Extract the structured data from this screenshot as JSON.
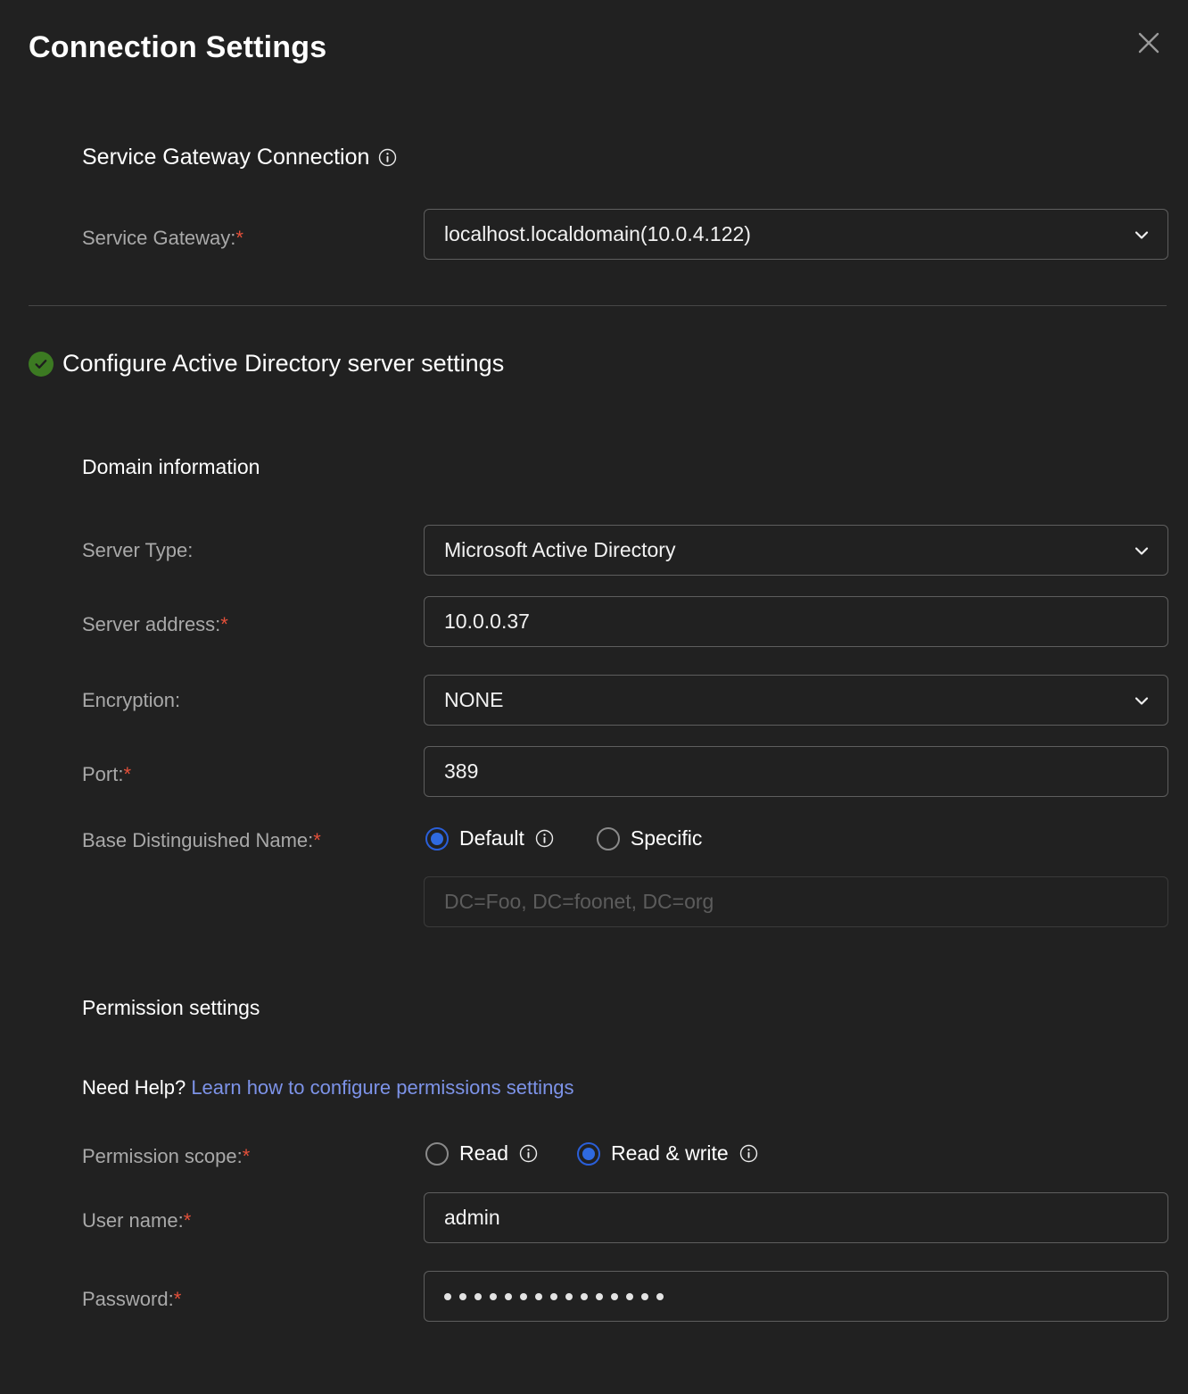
{
  "dialog": {
    "title": "Connection Settings",
    "close_icon": "close-icon"
  },
  "gateway_section": {
    "heading": "Service Gateway Connection",
    "info_icon": "info-icon",
    "label": "Service Gateway:",
    "required_mark": "*",
    "value": "localhost.localdomain(10.0.4.122)",
    "chevron_icon": "chevron-down-icon"
  },
  "ad_section": {
    "status_icon": "check-circle-icon",
    "heading": "Configure Active Directory server settings",
    "domain_subhead": "Domain information",
    "permission_subhead": "Permission settings",
    "fields": {
      "server_type": {
        "label": "Server Type:",
        "required_mark": "",
        "value": "Microsoft Active Directory",
        "chevron_icon": "chevron-down-icon"
      },
      "server_address": {
        "label": "Server address:",
        "required_mark": "*",
        "value": "10.0.0.37"
      },
      "encryption": {
        "label": "Encryption:",
        "required_mark": "",
        "value": "NONE",
        "chevron_icon": "chevron-down-icon"
      },
      "port": {
        "label": "Port:",
        "required_mark": "*",
        "value": "389"
      },
      "base_dn": {
        "label": "Base Distinguished Name:",
        "required_mark": "*",
        "options": [
          {
            "label": "Default",
            "selected": true,
            "info_icon": "info-icon"
          },
          {
            "label": "Specific",
            "selected": false,
            "info_icon": ""
          }
        ],
        "placeholder": "DC=Foo, DC=foonet, DC=org",
        "input_value": ""
      }
    },
    "help": {
      "prefix": "Need Help? ",
      "link_text": "Learn how to configure permissions settings"
    },
    "permission": {
      "label": "Permission scope:",
      "required_mark": "*",
      "options": [
        {
          "label": "Read",
          "selected": false,
          "info_icon": "info-icon"
        },
        {
          "label": "Read & write",
          "selected": true,
          "info_icon": "info-icon"
        }
      ]
    },
    "user_name": {
      "label": "User name:",
      "required_mark": "*",
      "value": "admin"
    },
    "password": {
      "label": "Password:",
      "required_mark": "*",
      "masked_value": "•••••••••••••••",
      "dot_count": 15
    }
  },
  "colors": {
    "background": "#212121",
    "accent_blue": "#2f6ae0",
    "link_blue": "#7d93e8",
    "required_red": "#e4503a",
    "success_green": "#3c7a22",
    "border_gray": "#5e5e5e",
    "label_gray": "#a9a9a9"
  }
}
